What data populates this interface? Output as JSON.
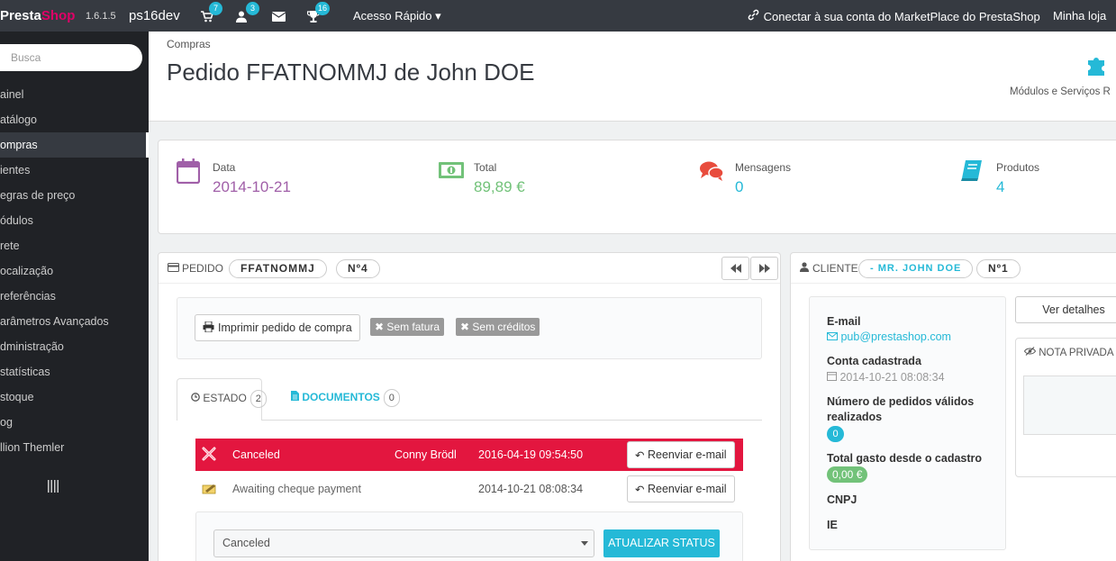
{
  "topbar": {
    "logo_presta": "Presta",
    "logo_shop": "Shop",
    "version": "1.6.1.5",
    "shop_name": "ps16dev",
    "cart_count": "7",
    "customers_count": "3",
    "trophy_count": "16",
    "quick_access": "Acesso Rápido",
    "marketplace": "Conectar à sua conta do MarketPlace do PrestaShop",
    "my_shop": "Minha loja"
  },
  "sidebar": {
    "search_placeholder": "Busca",
    "items": [
      {
        "label": "ainel"
      },
      {
        "label": "atálogo"
      },
      {
        "label": "ompras"
      },
      {
        "label": "ientes"
      },
      {
        "label": "egras de preço"
      },
      {
        "label": "ódulos"
      },
      {
        "label": "rete"
      },
      {
        "label": "ocalização"
      },
      {
        "label": "referências"
      },
      {
        "label": "arâmetros Avançados"
      },
      {
        "label": "dministração"
      },
      {
        "label": "statísticas"
      },
      {
        "label": "stoque"
      },
      {
        "label": "og"
      },
      {
        "label": "llion Themler"
      }
    ]
  },
  "header": {
    "breadcrumb": "Compras",
    "title": "Pedido FFATNOMMJ de John DOE",
    "modules_label": "Módulos e Serviços R"
  },
  "kpi": {
    "date_label": "Data",
    "date_value": "2014-10-21",
    "total_label": "Total",
    "total_value": "89,89 €",
    "messages_label": "Mensagens",
    "messages_value": "0",
    "products_label": "Produtos",
    "products_value": "4"
  },
  "order": {
    "title": "PEDIDO",
    "reference": "FFATNOMMJ",
    "number": "Nº4",
    "print_button": "Imprimir pedido de compra",
    "no_invoice": "Sem fatura",
    "no_credits": "Sem créditos",
    "tab_status": "ESTADO",
    "tab_status_count": "2",
    "tab_documents": "DOCUMENTOS",
    "tab_documents_count": "0",
    "history": [
      {
        "status": "Canceled",
        "employee": "Conny Brödl",
        "date": "2016-04-19 09:54:50",
        "action": "Reenviar e-mail"
      },
      {
        "status": "Awaiting cheque payment",
        "employee": "",
        "date": "2014-10-21 08:08:34",
        "action": "Reenviar e-mail"
      }
    ],
    "status_select": "Canceled",
    "update_button": "ATUALIZAR STATUS"
  },
  "customer": {
    "title": "CLIENTE",
    "name": "- MR. JOHN DOE",
    "number": "Nº1",
    "details_button": "Ver detalhes",
    "email_label": "E-mail",
    "email_value": "pub@prestashop.com",
    "registered_label": "Conta cadastrada",
    "registered_value": "2014-10-21 08:08:34",
    "valid_orders_label_1": "Número de pedidos válidos",
    "valid_orders_label_2": "realizados",
    "valid_orders_value": "0",
    "total_spent_label": "Total gasto desde o cadastro",
    "total_spent_value": "0,00 €",
    "cnpj_label": "CNPJ",
    "ie_label": "IE",
    "private_note_title": "NOTA PRIVADA"
  },
  "colors": {
    "accent": "#25b9d7",
    "date": "#a05fa8",
    "total": "#72c279",
    "messages": "#e84c3d",
    "canceled": "#e3163f"
  }
}
